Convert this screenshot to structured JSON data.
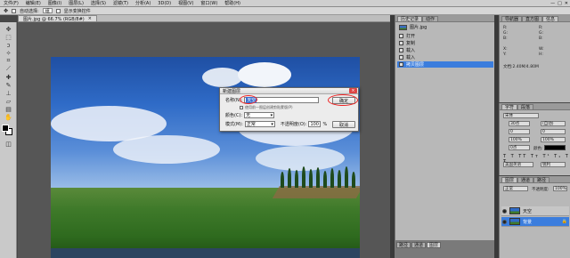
{
  "menubar": {
    "items": [
      "文件(F)",
      "编辑(E)",
      "图像(I)",
      "图层(L)",
      "选择(S)",
      "滤镜(T)",
      "分析(A)",
      "3D(D)",
      "视图(V)",
      "窗口(W)",
      "帮助(H)"
    ],
    "window_controls": [
      "—",
      "□",
      "✕"
    ]
  },
  "options_bar": {
    "auto_select_label": "自动选择:",
    "auto_select_value": "组",
    "show_transform_label": "显示变换控件"
  },
  "doc_tab": {
    "name": "图片.jpg @ 66.7% (RGB/8#)",
    "close": "×"
  },
  "dialog": {
    "title": "新建图层",
    "name_label": "名称(N):",
    "name_value": "天空",
    "checkbox_label": "使用前一图层创建剪贴蒙版(P)",
    "color_label": "颜色(C):",
    "color_value": "无",
    "mode_label": "模式(M):",
    "mode_value": "正常",
    "opacity_label": "不透明度(O):",
    "opacity_value": "100",
    "opacity_unit": "%",
    "ok_label": "确定",
    "cancel_label": "取消",
    "close": "×"
  },
  "history_panel": {
    "tabs": [
      "历史记录",
      "动作"
    ],
    "snapshot": "图片.jpg",
    "items": [
      "打开",
      "复制",
      "载入",
      "载入",
      "拷贝图层"
    ]
  },
  "bottom_panel_tabs": [
    "路径",
    "通道",
    "图层"
  ],
  "info_panel": {
    "tabs": [
      "导航器",
      "直方图",
      "信息"
    ],
    "rgb_labels": [
      "R:",
      "G:",
      "B:"
    ],
    "xy_labels": [
      "X:",
      "Y:"
    ],
    "wh_labels": [
      "W:",
      "H:"
    ],
    "doc_label": "文档:2.40M/4.80M"
  },
  "char_panel": {
    "tabs": [
      "字符",
      "段落"
    ],
    "font_value": "宋体",
    "size_value": "30点",
    "leading_value": "(自动)",
    "kerning_value": "0",
    "tracking_value": "0",
    "scale_v": "100%",
    "scale_h": "100%",
    "baseline_value": "0点",
    "color_label": "颜色:",
    "lang_value": "美国英语",
    "aa_value": "锐利"
  },
  "layers_panel": {
    "tabs": [
      "图层",
      "通道",
      "路径"
    ],
    "blend_mode": "正常",
    "opacity_label": "不透明度:",
    "opacity_value": "100%",
    "layers": [
      "天空",
      "背景"
    ]
  },
  "colors": {
    "accent": "#3b7ddd",
    "dialog_highlight": "#e22222"
  }
}
